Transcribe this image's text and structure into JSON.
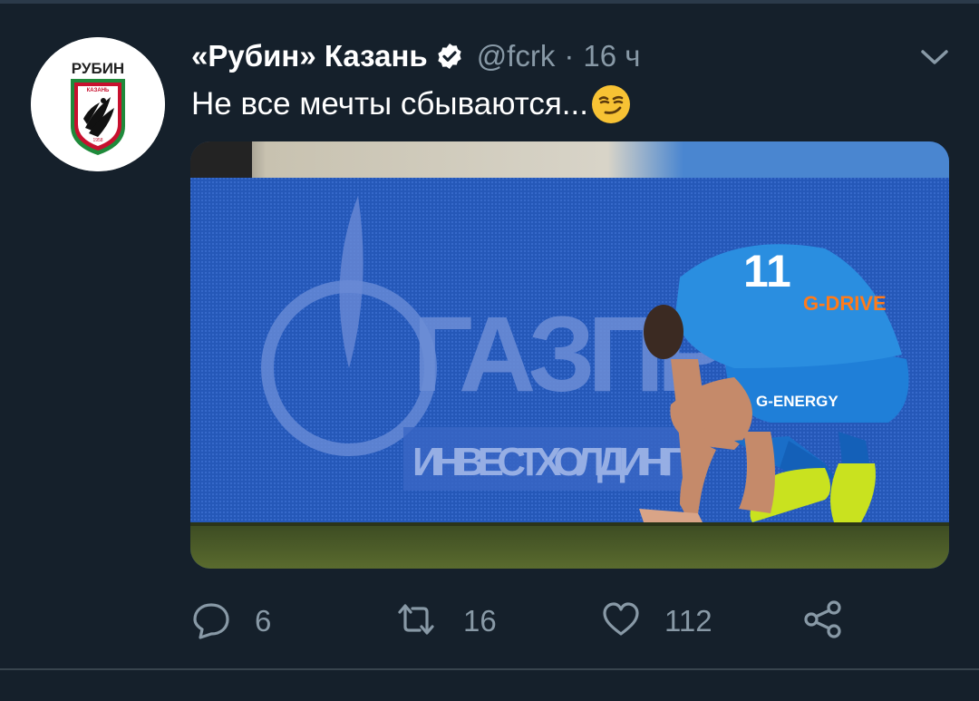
{
  "tweet": {
    "author": {
      "display_name": "«Рубин» Казань",
      "handle": "@fcrk",
      "verified": true,
      "avatar_text": "РУБИН",
      "avatar_subtext": "КАЗАНЬ",
      "avatar_year": "1958"
    },
    "separator": "·",
    "time": "16 ч",
    "text": "Не все мечты сбываются...",
    "emoji": "smirking-face",
    "media": {
      "banner_text": "ГАЗПРОМ",
      "banner_subtext": "ИНВЕСТХОЛДИНГ",
      "shirt_number": "11",
      "shirt_sponsor": "G-DRIVE",
      "shorts_sponsor": "G-ENERGY"
    },
    "actions": {
      "reply_count": "6",
      "retweet_count": "16",
      "like_count": "112"
    }
  },
  "colors": {
    "background": "#15202b",
    "secondary_text": "#8899a6",
    "primary_text": "#ffffff",
    "divider": "#38444d",
    "avatar_red": "#c8102e",
    "avatar_green": "#1f8a3b"
  },
  "icons": [
    "verified-icon",
    "chevron-down-icon",
    "reply-icon",
    "retweet-icon",
    "like-icon",
    "share-icon"
  ]
}
